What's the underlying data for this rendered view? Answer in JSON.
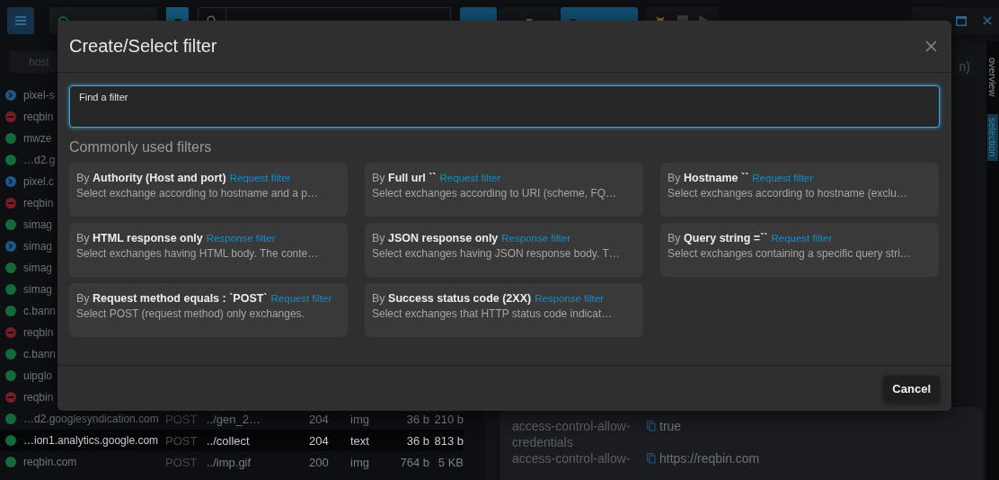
{
  "toolbar": {
    "buttons": [
      {
        "kind": "primary"
      },
      {
        "kind": "menu"
      },
      {
        "kind": "primary-menu"
      }
    ]
  },
  "exchanges": {
    "columns": [
      "host"
    ],
    "rows": [
      {
        "host": "pixel-s",
        "kind": "redirect",
        "selected": false
      },
      {
        "host": "reqbin",
        "kind": "error",
        "selected": false
      },
      {
        "host": "mwze",
        "kind": "success",
        "selected": false
      },
      {
        "host": "…d2.g",
        "kind": "success",
        "selected": false
      },
      {
        "host": "pixel.c",
        "kind": "redirect",
        "selected": false
      },
      {
        "host": "reqbin",
        "kind": "error",
        "selected": false
      },
      {
        "host": "simag",
        "kind": "success",
        "selected": false
      },
      {
        "host": "simag",
        "kind": "redirect",
        "selected": false
      },
      {
        "host": "simag",
        "kind": "success",
        "selected": false
      },
      {
        "host": "simag",
        "kind": "success",
        "selected": false
      },
      {
        "host": "c.bann",
        "kind": "success",
        "selected": false
      },
      {
        "host": "reqbin",
        "kind": "error",
        "selected": false
      },
      {
        "host": "c.bann",
        "kind": "success",
        "selected": false
      },
      {
        "host": "uipglo",
        "kind": "success",
        "selected": false
      },
      {
        "host": "reqbin",
        "kind": "error",
        "selected": false
      },
      {
        "host": "…d2.googlesyndication.com",
        "method": "POST",
        "path": "../gen_2…",
        "status": "204",
        "type": "img",
        "request_size": "36 b",
        "response_size": "210 b",
        "kind": "success",
        "selected": false
      },
      {
        "host": "…ion1.analytics.google.com",
        "method": "POST",
        "path": "../collect",
        "status": "204",
        "type": "text",
        "request_size": "36 b",
        "response_size": "813 b",
        "kind": "success",
        "selected": true
      },
      {
        "host": "reqbin.com",
        "method": "POST",
        "path": "../imp.gif",
        "status": "200",
        "type": "img",
        "request_size": "764 b",
        "response_size": "5 KB",
        "kind": "success",
        "selected": false
      }
    ]
  },
  "detail": {
    "partial_label": "n)",
    "headers": [
      {
        "name": "access-control-allow-credentials",
        "value": "true"
      },
      {
        "name": "access-control-allow-",
        "value": "https://reqbin.com"
      }
    ]
  },
  "side_tabs": [
    {
      "label": "overview",
      "selected": false
    },
    {
      "label": "selection",
      "selected": true
    }
  ],
  "dialog": {
    "title": "Create/Select filter",
    "search": {
      "label": "Find a filter"
    },
    "section_title": "Commonly used filters",
    "filters": [
      {
        "title": "By **Authority (Host and port)**",
        "tag": "Request filter",
        "description": "Select exchange according to hostname and a p…"
      },
      {
        "title": "By **Full url ``**",
        "tag": "Request filter",
        "description": "Select exchanges according to URI (scheme, FQ…"
      },
      {
        "title": "By **Hostname ``**",
        "tag": "Request filter",
        "description": "Select exchanges according to hostname (exclu…"
      },
      {
        "title": "By **HTML response only**",
        "tag": "Response filter",
        "description": "Select exchanges having HTML body. The conte…"
      },
      {
        "title": "By **JSON response only**",
        "tag": "Response filter",
        "description": "Select exchanges having JSON response body. T…"
      },
      {
        "title": "By **Query string =``**",
        "tag": "Request filter",
        "description": "Select exchanges containing a specific query stri…"
      },
      {
        "title": "By **Request method equals : `POST`**",
        "tag": "Request filter",
        "description": "Select POST (request method) only exchanges."
      },
      {
        "title": "By **Success status code (2XX)**",
        "tag": "Response filter",
        "description": "Select exchanges that HTTP status code indicat…"
      }
    ],
    "buttons": [
      "Cancel"
    ]
  }
}
